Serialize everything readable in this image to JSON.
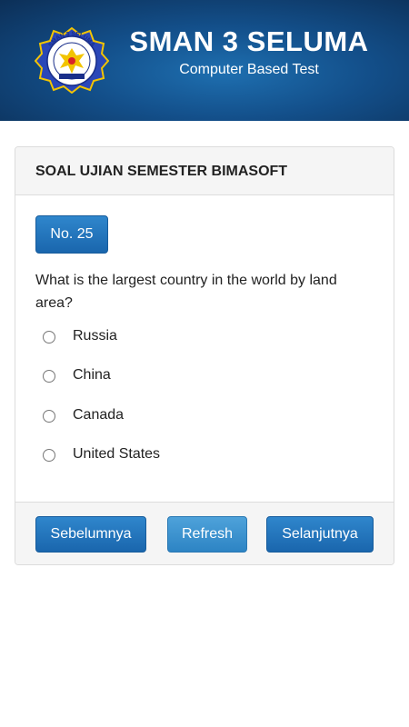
{
  "header": {
    "school_name": "SMAN 3 SELUMA",
    "subtitle": "Computer Based Test",
    "logo_text": "SMAN 3 SELUMA",
    "logo_icon": "school-emblem"
  },
  "panel": {
    "title": "SOAL UJIAN SEMESTER BIMASOFT",
    "question_number": "No. 25",
    "question": "What is the largest country in the world by land area?",
    "options": [
      "Russia",
      "China",
      "Canada",
      "United States"
    ]
  },
  "footer": {
    "prev_label": "Sebelumnya",
    "refresh_label": "Refresh",
    "next_label": "Selanjutnya"
  },
  "colors": {
    "header_dark": "#0c2f57",
    "header_light": "#1e6fb0",
    "primary_button": "#1a66ad",
    "info_button": "#2d84c4"
  }
}
